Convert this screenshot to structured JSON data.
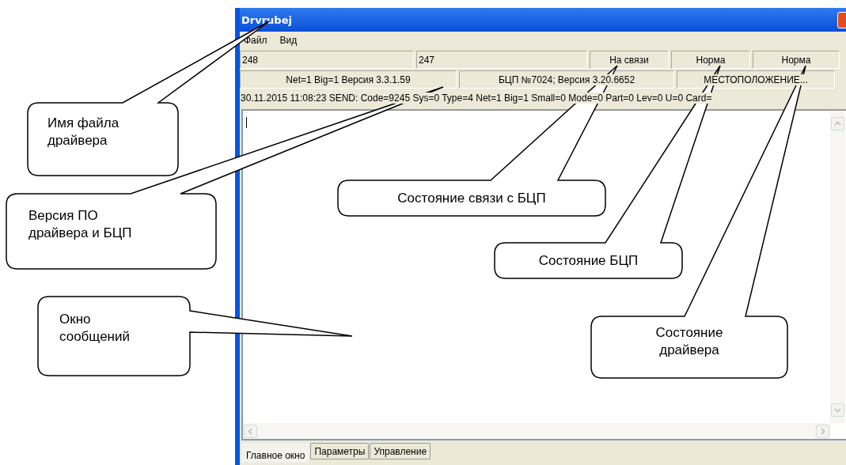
{
  "window": {
    "title": "Drvrubej"
  },
  "menu": [
    "Файл",
    "Вид"
  ],
  "status_row_1": [
    "248",
    "247",
    "На связи",
    "Норма",
    "Норма"
  ],
  "status_row_2": [
    "Net=1 Big=1 Версия 3.3.1.59",
    "БЦП №7024; Версия 3.20.6652",
    "МЕСТОПОЛОЖЕНИЕ..."
  ],
  "log_line": "30.11.2015 11:08:23  SEND: Code=9245 Sys=0 Type=4 Net=1 Big=1 Small=0 Mode=0 Part=0 Lev=0 U=0 Card=",
  "tabs": [
    {
      "label": "Главное окно",
      "selected": true
    },
    {
      "label": "Параметры",
      "selected": false
    },
    {
      "label": "Управление",
      "selected": false
    }
  ],
  "callouts": [
    "Имя файла\nдрайвера",
    "Версия ПО\nдрайвера и БЦП",
    "Окно\nсообщений",
    "Состояние связи с БЦП",
    "Состояние БЦП",
    "Состояние\nдрайвера"
  ]
}
